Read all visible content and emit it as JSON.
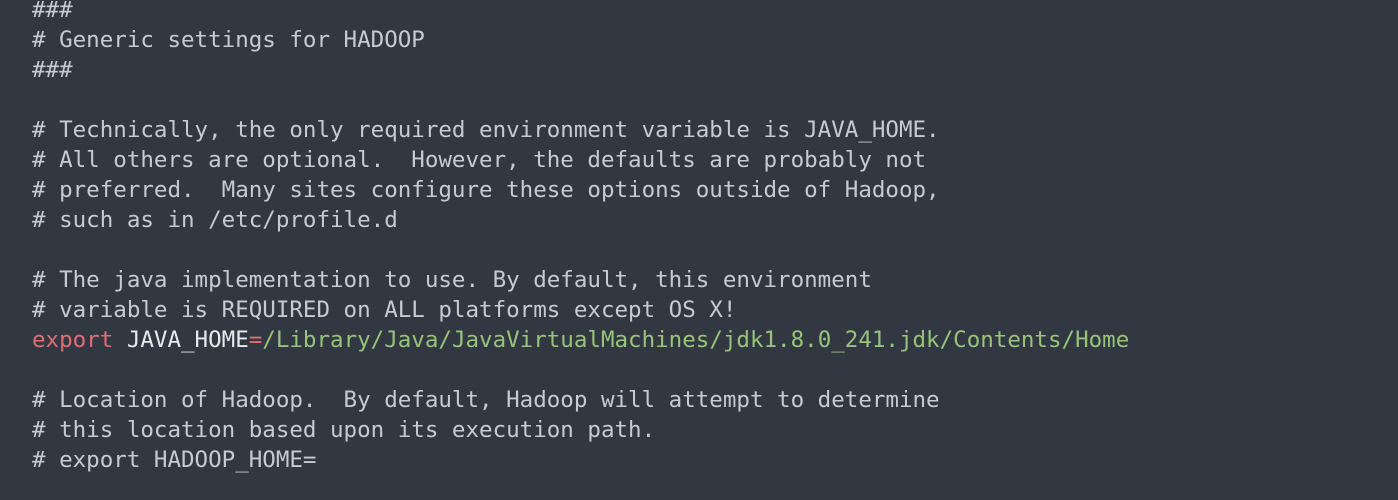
{
  "colors": {
    "background": "#323842",
    "comment": "#c5cad3",
    "keyword": "#e06c75",
    "variable": "#e6e9ee",
    "string": "#98c379"
  },
  "code": {
    "l1": "###",
    "l2": "# Generic settings for HADOOP",
    "l3": "###",
    "l4": "",
    "l5": "# Technically, the only required environment variable is JAVA_HOME.",
    "l6": "# All others are optional.  However, the defaults are probably not",
    "l7": "# preferred.  Many sites configure these options outside of Hadoop,",
    "l8": "# such as in /etc/profile.d",
    "l9": "",
    "l10": "# The java implementation to use. By default, this environment",
    "l11": "# variable is REQUIRED on ALL platforms except OS X!",
    "l12": {
      "keyword": "export",
      "space": " ",
      "variable": "JAVA_HOME",
      "operator": "=",
      "value": "/Library/Java/JavaVirtualMachines/jdk1.8.0_241.jdk/Contents/Home"
    },
    "l13": "",
    "l14": "# Location of Hadoop.  By default, Hadoop will attempt to determine",
    "l15": "# this location based upon its execution path.",
    "l16": "# export HADOOP_HOME="
  }
}
